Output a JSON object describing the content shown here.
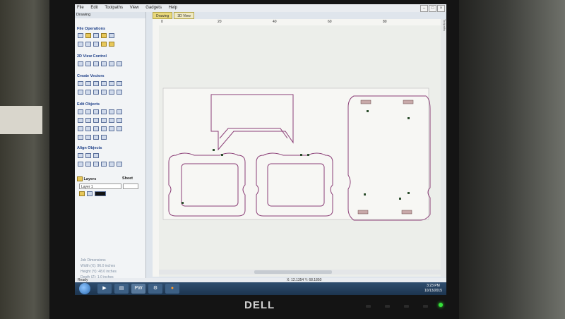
{
  "menu": [
    "File",
    "Edit",
    "Toolpaths",
    "View",
    "Gadgets",
    "Help"
  ],
  "panel_title": "Drawing",
  "sections": {
    "file_ops": "File Operations",
    "view_2d": "2D View Control",
    "create_vectors": "Create Vectors",
    "edit_objects": "Edit Objects",
    "align_objects": "Align Objects",
    "layers": "Layers",
    "sheet": "Sheet"
  },
  "layer_name": "Layer 1",
  "job_dims": {
    "label": "Job Dimensions",
    "width": "Width  (X): 96.0 inches",
    "height": "Height (Y): 48.0 inches",
    "depth": "Depth  (Z): 1.0 inches"
  },
  "tabs": [
    {
      "label": "Drawing"
    },
    {
      "label": "3D View"
    }
  ],
  "ruler_top": [
    "0",
    "20",
    "40",
    "60",
    "80"
  ],
  "right_panel_label": "Toolpaths",
  "status": {
    "left": "Ready",
    "center": "X: 12.1354 Y: 68.1850"
  },
  "taskbar": {
    "pw_label": "PW",
    "time": "3:23 PM",
    "date": "10/13/2015"
  },
  "monitor_brand": "DELL",
  "colors": {
    "vector_path": "#8b3f77",
    "node": "#2d4f2e",
    "tab_active": "#e8d87c",
    "power_led": "#36e13a"
  }
}
